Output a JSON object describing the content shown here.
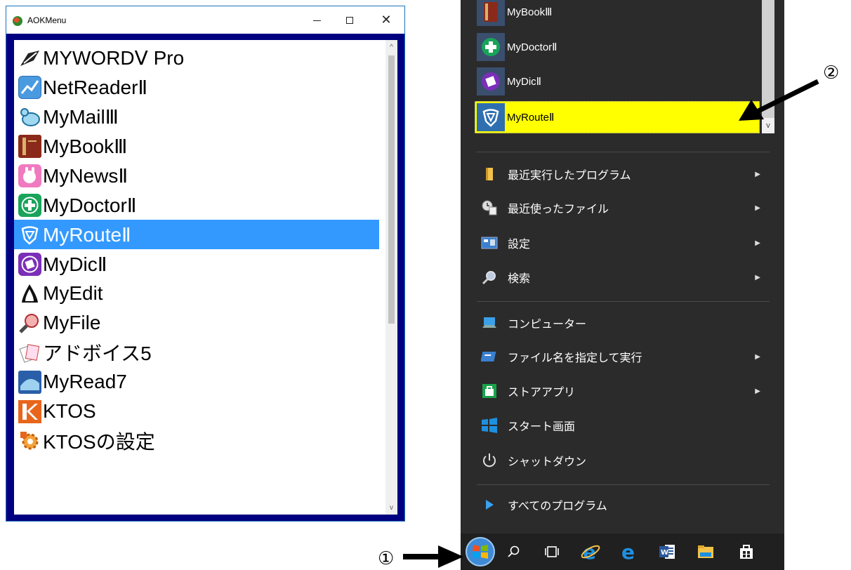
{
  "aok_window": {
    "title": "AOKMenu",
    "buttons": {
      "minimize": "—",
      "maximize": "☐",
      "close": "✕"
    },
    "items": [
      {
        "label": "MYWORDⅤ Pro",
        "icon": "pen-nib-icon",
        "selected": false
      },
      {
        "label": "NetReaderⅡ",
        "icon": "netreader-icon",
        "selected": false
      },
      {
        "label": "MyMailⅢ",
        "icon": "bird-icon",
        "selected": false
      },
      {
        "label": "MyBookⅢ",
        "icon": "book-icon",
        "selected": false
      },
      {
        "label": "MyNewsⅡ",
        "icon": "news-bunny-icon",
        "selected": false
      },
      {
        "label": "MyDoctorⅡ",
        "icon": "medical-cross-icon",
        "selected": false
      },
      {
        "label": "MyRouteⅡ",
        "icon": "route-shield-icon",
        "selected": true
      },
      {
        "label": "MyDicⅡ",
        "icon": "dictionary-icon",
        "selected": false
      },
      {
        "label": "MyEdit",
        "icon": "penguin-icon",
        "selected": false
      },
      {
        "label": "MyFile",
        "icon": "magnifier-file-icon",
        "selected": false
      },
      {
        "label": "アドボイス5",
        "icon": "cards-icon",
        "selected": false
      },
      {
        "label": "MyRead7",
        "icon": "reader-icon",
        "selected": false
      },
      {
        "label": "KTOS",
        "icon": "ktos-k-icon",
        "selected": false
      },
      {
        "label": "KTOSの設定",
        "icon": "settings-gear-icon",
        "selected": false
      }
    ],
    "scroll_up": "^",
    "scroll_down": "v"
  },
  "start_menu": {
    "apps": [
      {
        "label": "MyBookⅢ",
        "icon": "book-icon",
        "color": "#3a4f6e"
      },
      {
        "label": "MyDoctorⅡ",
        "icon": "medical-cross-icon",
        "color": "#3a4f6e"
      },
      {
        "label": "MyDicⅡ",
        "icon": "dictionary-icon",
        "color": "#3a4f6e"
      },
      {
        "label": "MyRouteⅡ",
        "icon": "route-shield-icon",
        "color": "#2f6fb0",
        "highlighted": true
      }
    ],
    "scroll_down": "v",
    "menu": [
      {
        "label": "最近実行したプログラム",
        "icon": "folder-icon",
        "has_submenu": true
      },
      {
        "label": "最近使ったファイル",
        "icon": "recent-files-icon",
        "has_submenu": true
      },
      {
        "label": "設定",
        "icon": "control-panel-icon",
        "has_submenu": true
      },
      {
        "label": "検索",
        "icon": "search-icon",
        "has_submenu": true
      },
      {
        "label": "コンピューター",
        "icon": "computer-icon",
        "has_submenu": false
      },
      {
        "label": "ファイル名を指定して実行",
        "icon": "run-icon",
        "has_submenu": true
      },
      {
        "label": "ストアアプリ",
        "icon": "store-icon",
        "has_submenu": true
      },
      {
        "label": "スタート画面",
        "icon": "windows-logo-icon",
        "has_submenu": false
      },
      {
        "label": "シャットダウン",
        "icon": "power-icon",
        "has_submenu": false
      },
      {
        "label": "すべてのプログラム",
        "icon": "play-arrow-icon",
        "has_submenu": false
      }
    ],
    "submenu_arrow": "▶"
  },
  "taskbar": {
    "buttons": [
      "start-orb-icon",
      "search-icon",
      "task-view-icon",
      "ie-icon",
      "edge-icon",
      "word-icon",
      "file-explorer-icon",
      "store-bag-icon"
    ]
  },
  "annotations": {
    "marker_1": "①",
    "marker_2": "②"
  },
  "colors": {
    "selection": "#3399ff",
    "highlight": "#ffff00",
    "start_bg": "#2b2b2b",
    "window_frame": "#000080"
  }
}
